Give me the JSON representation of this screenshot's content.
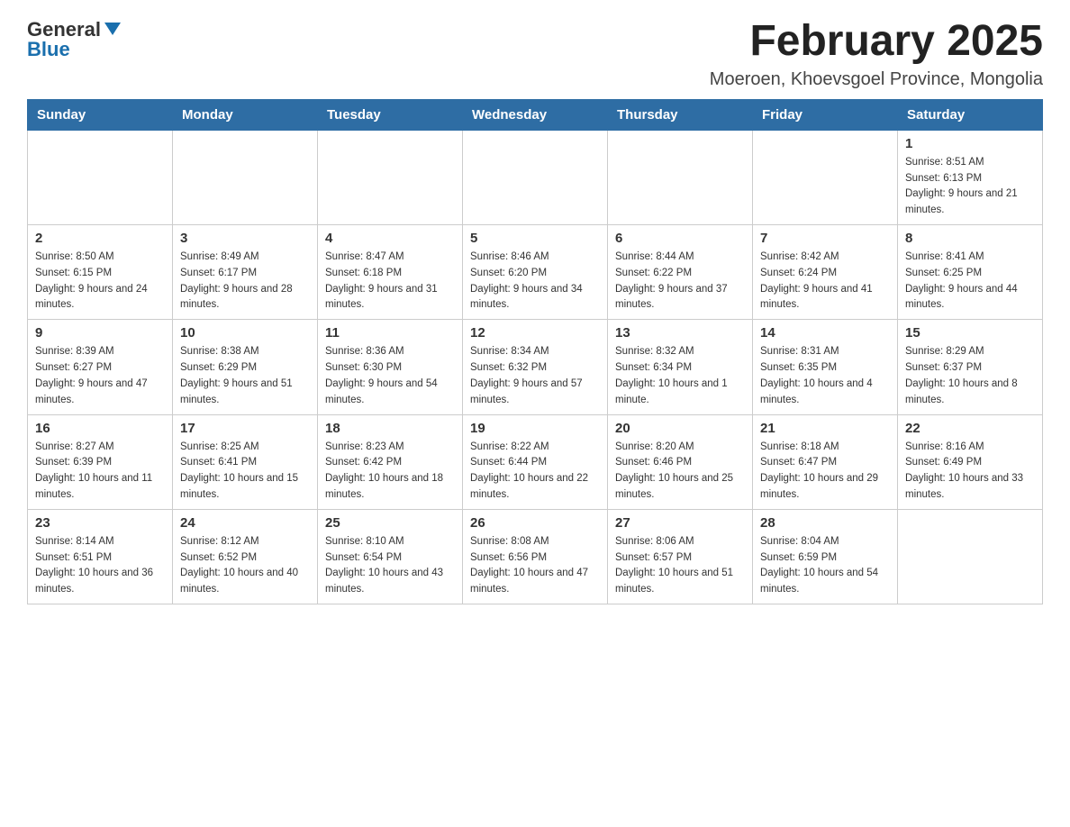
{
  "logo": {
    "text_general": "General",
    "text_blue": "Blue"
  },
  "title": "February 2025",
  "subtitle": "Moeroen, Khoevsgoel Province, Mongolia",
  "weekdays": [
    "Sunday",
    "Monday",
    "Tuesday",
    "Wednesday",
    "Thursday",
    "Friday",
    "Saturday"
  ],
  "weeks": [
    [
      {
        "day": "",
        "sunrise": "",
        "sunset": "",
        "daylight": ""
      },
      {
        "day": "",
        "sunrise": "",
        "sunset": "",
        "daylight": ""
      },
      {
        "day": "",
        "sunrise": "",
        "sunset": "",
        "daylight": ""
      },
      {
        "day": "",
        "sunrise": "",
        "sunset": "",
        "daylight": ""
      },
      {
        "day": "",
        "sunrise": "",
        "sunset": "",
        "daylight": ""
      },
      {
        "day": "",
        "sunrise": "",
        "sunset": "",
        "daylight": ""
      },
      {
        "day": "1",
        "sunrise": "Sunrise: 8:51 AM",
        "sunset": "Sunset: 6:13 PM",
        "daylight": "Daylight: 9 hours and 21 minutes."
      }
    ],
    [
      {
        "day": "2",
        "sunrise": "Sunrise: 8:50 AM",
        "sunset": "Sunset: 6:15 PM",
        "daylight": "Daylight: 9 hours and 24 minutes."
      },
      {
        "day": "3",
        "sunrise": "Sunrise: 8:49 AM",
        "sunset": "Sunset: 6:17 PM",
        "daylight": "Daylight: 9 hours and 28 minutes."
      },
      {
        "day": "4",
        "sunrise": "Sunrise: 8:47 AM",
        "sunset": "Sunset: 6:18 PM",
        "daylight": "Daylight: 9 hours and 31 minutes."
      },
      {
        "day": "5",
        "sunrise": "Sunrise: 8:46 AM",
        "sunset": "Sunset: 6:20 PM",
        "daylight": "Daylight: 9 hours and 34 minutes."
      },
      {
        "day": "6",
        "sunrise": "Sunrise: 8:44 AM",
        "sunset": "Sunset: 6:22 PM",
        "daylight": "Daylight: 9 hours and 37 minutes."
      },
      {
        "day": "7",
        "sunrise": "Sunrise: 8:42 AM",
        "sunset": "Sunset: 6:24 PM",
        "daylight": "Daylight: 9 hours and 41 minutes."
      },
      {
        "day": "8",
        "sunrise": "Sunrise: 8:41 AM",
        "sunset": "Sunset: 6:25 PM",
        "daylight": "Daylight: 9 hours and 44 minutes."
      }
    ],
    [
      {
        "day": "9",
        "sunrise": "Sunrise: 8:39 AM",
        "sunset": "Sunset: 6:27 PM",
        "daylight": "Daylight: 9 hours and 47 minutes."
      },
      {
        "day": "10",
        "sunrise": "Sunrise: 8:38 AM",
        "sunset": "Sunset: 6:29 PM",
        "daylight": "Daylight: 9 hours and 51 minutes."
      },
      {
        "day": "11",
        "sunrise": "Sunrise: 8:36 AM",
        "sunset": "Sunset: 6:30 PM",
        "daylight": "Daylight: 9 hours and 54 minutes."
      },
      {
        "day": "12",
        "sunrise": "Sunrise: 8:34 AM",
        "sunset": "Sunset: 6:32 PM",
        "daylight": "Daylight: 9 hours and 57 minutes."
      },
      {
        "day": "13",
        "sunrise": "Sunrise: 8:32 AM",
        "sunset": "Sunset: 6:34 PM",
        "daylight": "Daylight: 10 hours and 1 minute."
      },
      {
        "day": "14",
        "sunrise": "Sunrise: 8:31 AM",
        "sunset": "Sunset: 6:35 PM",
        "daylight": "Daylight: 10 hours and 4 minutes."
      },
      {
        "day": "15",
        "sunrise": "Sunrise: 8:29 AM",
        "sunset": "Sunset: 6:37 PM",
        "daylight": "Daylight: 10 hours and 8 minutes."
      }
    ],
    [
      {
        "day": "16",
        "sunrise": "Sunrise: 8:27 AM",
        "sunset": "Sunset: 6:39 PM",
        "daylight": "Daylight: 10 hours and 11 minutes."
      },
      {
        "day": "17",
        "sunrise": "Sunrise: 8:25 AM",
        "sunset": "Sunset: 6:41 PM",
        "daylight": "Daylight: 10 hours and 15 minutes."
      },
      {
        "day": "18",
        "sunrise": "Sunrise: 8:23 AM",
        "sunset": "Sunset: 6:42 PM",
        "daylight": "Daylight: 10 hours and 18 minutes."
      },
      {
        "day": "19",
        "sunrise": "Sunrise: 8:22 AM",
        "sunset": "Sunset: 6:44 PM",
        "daylight": "Daylight: 10 hours and 22 minutes."
      },
      {
        "day": "20",
        "sunrise": "Sunrise: 8:20 AM",
        "sunset": "Sunset: 6:46 PM",
        "daylight": "Daylight: 10 hours and 25 minutes."
      },
      {
        "day": "21",
        "sunrise": "Sunrise: 8:18 AM",
        "sunset": "Sunset: 6:47 PM",
        "daylight": "Daylight: 10 hours and 29 minutes."
      },
      {
        "day": "22",
        "sunrise": "Sunrise: 8:16 AM",
        "sunset": "Sunset: 6:49 PM",
        "daylight": "Daylight: 10 hours and 33 minutes."
      }
    ],
    [
      {
        "day": "23",
        "sunrise": "Sunrise: 8:14 AM",
        "sunset": "Sunset: 6:51 PM",
        "daylight": "Daylight: 10 hours and 36 minutes."
      },
      {
        "day": "24",
        "sunrise": "Sunrise: 8:12 AM",
        "sunset": "Sunset: 6:52 PM",
        "daylight": "Daylight: 10 hours and 40 minutes."
      },
      {
        "day": "25",
        "sunrise": "Sunrise: 8:10 AM",
        "sunset": "Sunset: 6:54 PM",
        "daylight": "Daylight: 10 hours and 43 minutes."
      },
      {
        "day": "26",
        "sunrise": "Sunrise: 8:08 AM",
        "sunset": "Sunset: 6:56 PM",
        "daylight": "Daylight: 10 hours and 47 minutes."
      },
      {
        "day": "27",
        "sunrise": "Sunrise: 8:06 AM",
        "sunset": "Sunset: 6:57 PM",
        "daylight": "Daylight: 10 hours and 51 minutes."
      },
      {
        "day": "28",
        "sunrise": "Sunrise: 8:04 AM",
        "sunset": "Sunset: 6:59 PM",
        "daylight": "Daylight: 10 hours and 54 minutes."
      },
      {
        "day": "",
        "sunrise": "",
        "sunset": "",
        "daylight": ""
      }
    ]
  ],
  "colors": {
    "header_bg": "#2e6da4",
    "header_text": "#ffffff",
    "border": "#cccccc"
  }
}
